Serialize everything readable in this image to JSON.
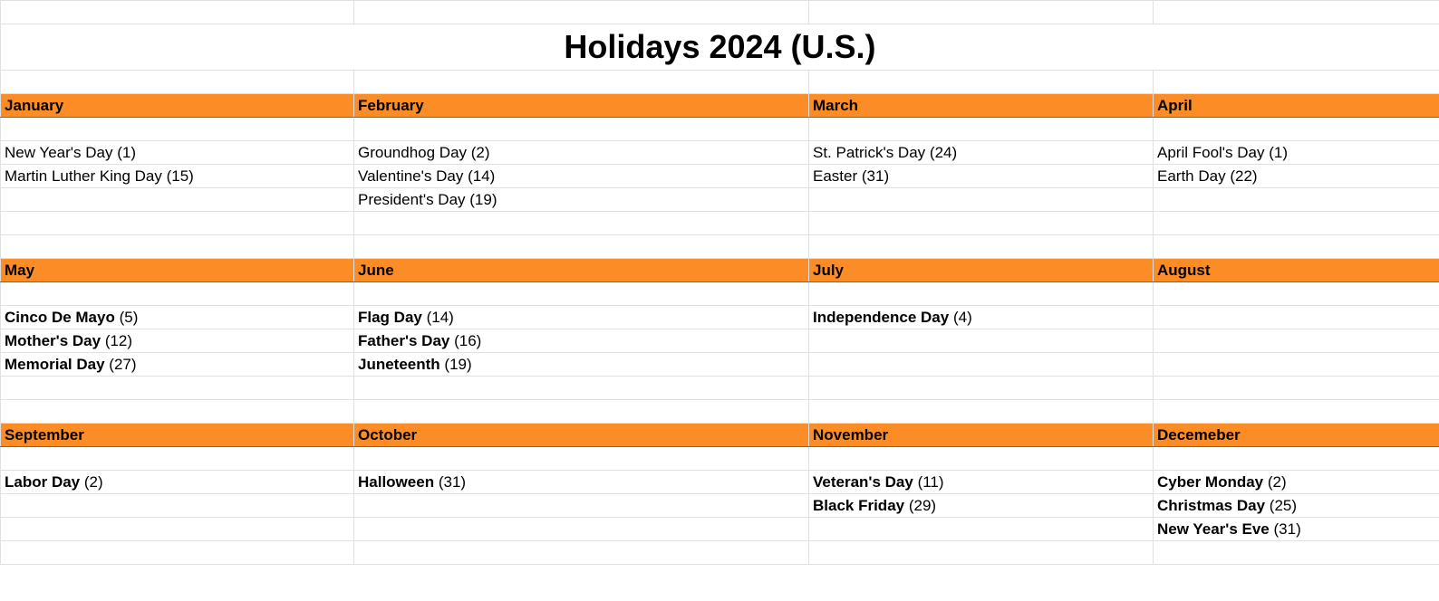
{
  "title": "Holidays 2024 (U.S.)",
  "accent_color": "#fb8c26",
  "chart_data": {
    "type": "table",
    "title": "Holidays 2024 (U.S.)",
    "groups": [
      {
        "months": [
          "January",
          "February",
          "March",
          "April"
        ],
        "rows": [
          [
            {
              "name": "New Year's Day",
              "day": 1,
              "bold": false
            },
            {
              "name": "Groundhog Day",
              "day": 2,
              "bold": false
            },
            {
              "name": "St. Patrick's Day",
              "day": 24,
              "bold": false
            },
            {
              "name": "April Fool's Day",
              "day": 1,
              "bold": false
            }
          ],
          [
            {
              "name": "Martin Luther King Day",
              "day": 15,
              "bold": false
            },
            {
              "name": "Valentine's Day",
              "day": 14,
              "bold": false
            },
            {
              "name": "Easter",
              "day": 31,
              "bold": false
            },
            {
              "name": "Earth Day",
              "day": 22,
              "bold": false
            }
          ],
          [
            null,
            {
              "name": "President's Day",
              "day": 19,
              "bold": false
            },
            null,
            null
          ],
          [
            null,
            null,
            null,
            null
          ],
          [
            null,
            null,
            null,
            null
          ]
        ]
      },
      {
        "months": [
          "May",
          "June",
          "July",
          "August"
        ],
        "rows": [
          [
            {
              "name": "Cinco De Mayo",
              "day": 5,
              "bold": true
            },
            {
              "name": "Flag Day",
              "day": 14,
              "bold": true
            },
            {
              "name": "Independence Day",
              "day": 4,
              "bold": true
            },
            null
          ],
          [
            {
              "name": "Mother's Day",
              "day": 12,
              "bold": true
            },
            {
              "name": "Father's Day",
              "day": 16,
              "bold": true
            },
            null,
            null
          ],
          [
            {
              "name": "Memorial Day",
              "day": 27,
              "bold": true
            },
            {
              "name": "Juneteenth",
              "day": 19,
              "bold": true
            },
            null,
            null
          ],
          [
            null,
            null,
            null,
            null
          ],
          [
            null,
            null,
            null,
            null
          ]
        ]
      },
      {
        "months": [
          "September",
          "October",
          "November",
          "Decemeber"
        ],
        "rows": [
          [
            {
              "name": "Labor Day",
              "day": 2,
              "bold": true
            },
            {
              "name": "Halloween",
              "day": 31,
              "bold": true
            },
            {
              "name": "Veteran's Day",
              "day": 11,
              "bold": true
            },
            {
              "name": "Cyber Monday",
              "day": 2,
              "bold": true
            }
          ],
          [
            null,
            null,
            {
              "name": "Black Friday",
              "day": 29,
              "bold": true
            },
            {
              "name": "Christmas Day",
              "day": 25,
              "bold": true
            }
          ],
          [
            null,
            null,
            null,
            {
              "name": "New Year's Eve",
              "day": 31,
              "bold": true
            }
          ],
          [
            null,
            null,
            null,
            null
          ]
        ]
      }
    ]
  }
}
